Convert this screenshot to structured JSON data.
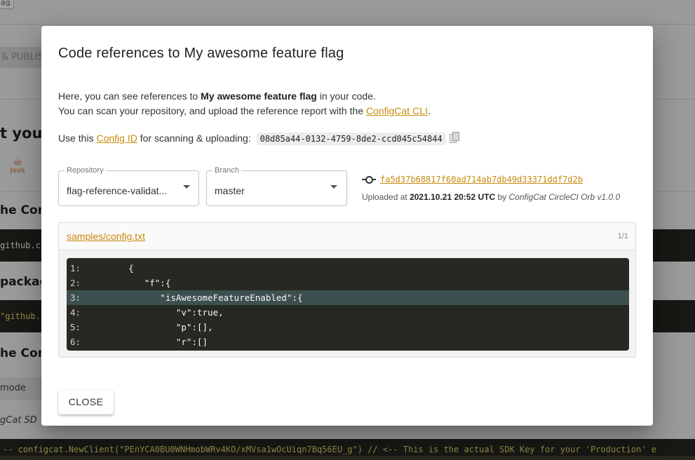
{
  "background": {
    "top_flag": "ag",
    "publish_label": "& PUBLIS",
    "heading_1": "t your",
    "java_label": "Java",
    "heading_2": "he Conf",
    "code_1": "github.c",
    "heading_3": "packag",
    "code_2": "\"github.",
    "heading_4": "he Con",
    "mode_label": "mode",
    "italic_text": "gCat SD",
    "code_bottom": "-- configcat.NewClient(\"PEnYCA0BU0WNHmobWRv4KO/xMVsa1wOcUiqn7Bq56EU_g\") // <-- This is the actual SDK Key for your 'Production' e"
  },
  "dialog": {
    "title": "Code references to My awesome feature flag",
    "intro_prefix": "Here, you can see references to ",
    "flag_name": "My awesome feature flag",
    "intro_suffix": " in your code.",
    "scan_prefix": "You can scan your repository, and upload the reference report with the ",
    "cli_link": "ConfigCat CLI",
    "scan_suffix": ".",
    "use_prefix": "Use this ",
    "config_id_link": "Config ID",
    "use_suffix": " for scanning & uploading:",
    "config_id": "08d85a44-0132-4759-8de2-ccd045c54844",
    "repository": {
      "label": "Repository",
      "value": "flag-reference-validat..."
    },
    "branch": {
      "label": "Branch",
      "value": "master"
    },
    "commit_hash": "fa5d37b68817f60ad714ab7db49d33371ddf7d2b",
    "uploaded_prefix": "Uploaded at ",
    "uploaded_date": "2021.10.21 20:52 UTC",
    "uploaded_by": " by ",
    "uploader": "ConfigCat CircleCI Orb v1.0.0",
    "file": {
      "name": "samples/config.txt",
      "count": "1/1",
      "lines": [
        {
          "no": "1:",
          "text": "      {"
        },
        {
          "no": "2:",
          "text": "         \"f\":{"
        },
        {
          "no": "3:",
          "text": "            \"isAwesomeFeatureEnabled\":{"
        },
        {
          "no": "4:",
          "text": "               \"v\":true,"
        },
        {
          "no": "5:",
          "text": "               \"p\":[],"
        },
        {
          "no": "6:",
          "text": "               \"r\":[]"
        }
      ],
      "highlight_line": 3
    },
    "close_label": "CLOSE"
  },
  "colors": {
    "link": "#c98a0c",
    "code_bg": "#272822",
    "highlight": "#3d4f4f"
  }
}
